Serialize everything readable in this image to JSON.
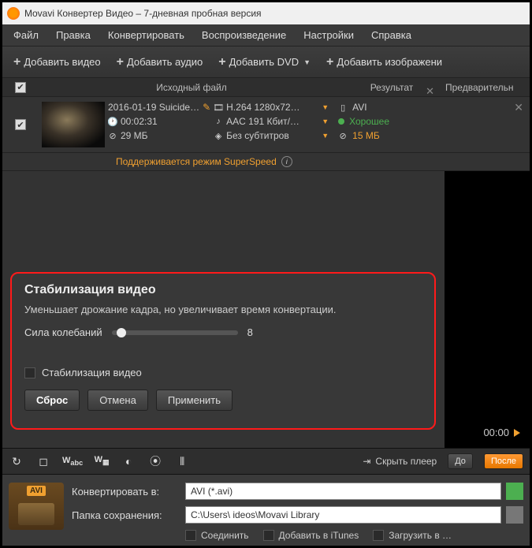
{
  "title": "Movavi Конвертер Видео – 7-дневная пробная версия",
  "menu": [
    "Файл",
    "Правка",
    "Конвертировать",
    "Воспроизведение",
    "Настройки",
    "Справка"
  ],
  "toolbar": {
    "add_video": "Добавить видео",
    "add_audio": "Добавить аудио",
    "add_dvd": "Добавить DVD",
    "add_image": "Добавить изображени"
  },
  "columns": {
    "source": "Исходный файл",
    "result": "Результат",
    "preview": "Предварительн"
  },
  "file": {
    "name": "2016-01-19 Suicide…",
    "duration": "00:02:31",
    "size": "29 МБ",
    "video_codec": "H.264 1280x72…",
    "audio_codec": "AAC 191 Кбит/…",
    "subtitles": "Без субтитров",
    "speed_note": "Поддерживается режим SuperSpeed"
  },
  "result": {
    "format": "AVI",
    "quality": "Хорошее",
    "size": "15 МБ"
  },
  "stab": {
    "title": "Стабилизация видео",
    "desc": "Уменьшает дрожание кадра, но увеличивает время конвертации.",
    "slider_label": "Сила колебаний",
    "slider_value": "8",
    "checkbox_label": "Стабилизация видео",
    "reset": "Сброс",
    "cancel": "Отмена",
    "apply": "Применить"
  },
  "player": {
    "time": "00:00",
    "hide": "Скрыть плеер",
    "before": "До",
    "after": "После"
  },
  "bottom": {
    "badge": "AVI",
    "convert_to_label": "Конвертировать в:",
    "convert_to_value": "AVI (*.avi)",
    "save_folder_label": "Папка сохранения:",
    "save_folder_value": "C:\\Users\\        ideos\\Movavi Library",
    "join": "Соединить",
    "itunes": "Добавить в iTunes",
    "upload": "Загрузить в …"
  }
}
